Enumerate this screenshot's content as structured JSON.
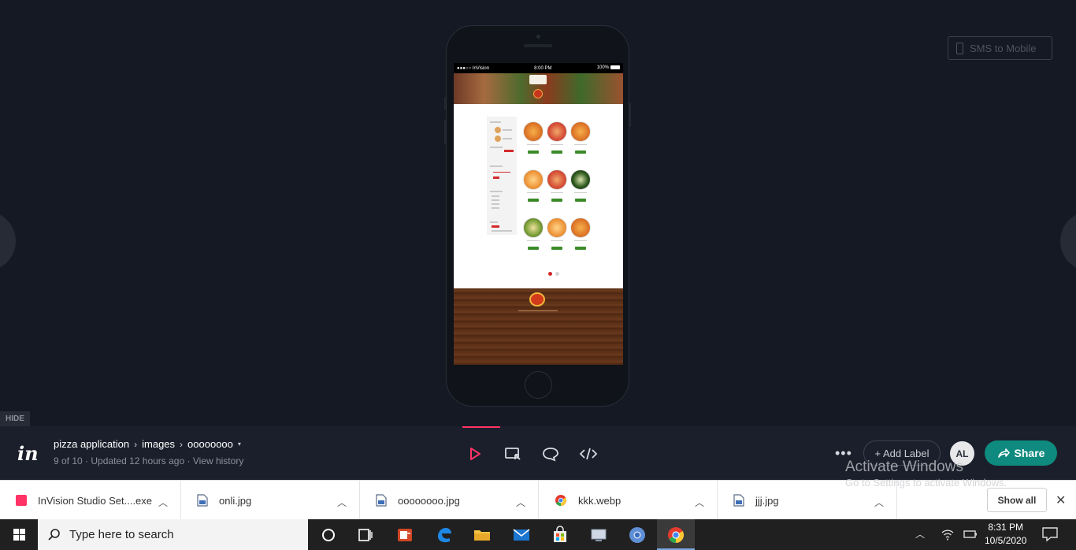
{
  "prototype": {
    "sms_button_label": "SMS to Mobile",
    "hide_tab_label": "HIDE",
    "phone_status": {
      "carrier": "●●●○○ InVision",
      "time": "8:00 PM",
      "battery": "100%"
    }
  },
  "bottom_bar": {
    "logo": "in",
    "breadcrumb": {
      "project": "pizza application",
      "section": "images",
      "screen": "oooooooo"
    },
    "screen_position": "9 of 10",
    "updated": "Updated 12 hours ago",
    "view_history": "View history",
    "more": "•••",
    "add_label": "+ Add Label",
    "avatar_initials": "AL",
    "share_label": "Share",
    "accent_color": "#ff3366",
    "share_color": "#0f8a7f"
  },
  "watermark": {
    "line1": "Activate Windows",
    "line2": "Go to Settings to activate Windows."
  },
  "downloads": {
    "items": [
      {
        "name": "InVision Studio Set....exe",
        "icon": "invision-installer-icon"
      },
      {
        "name": "onli.jpg",
        "icon": "file-icon"
      },
      {
        "name": "oooooooo.jpg",
        "icon": "file-icon"
      },
      {
        "name": "kkk.webp",
        "icon": "chrome-icon"
      },
      {
        "name": "jjj.jpg",
        "icon": "file-icon"
      }
    ],
    "show_all": "Show all"
  },
  "taskbar": {
    "search_placeholder": "Type here to search",
    "time": "8:31 PM",
    "date": "10/5/2020"
  }
}
